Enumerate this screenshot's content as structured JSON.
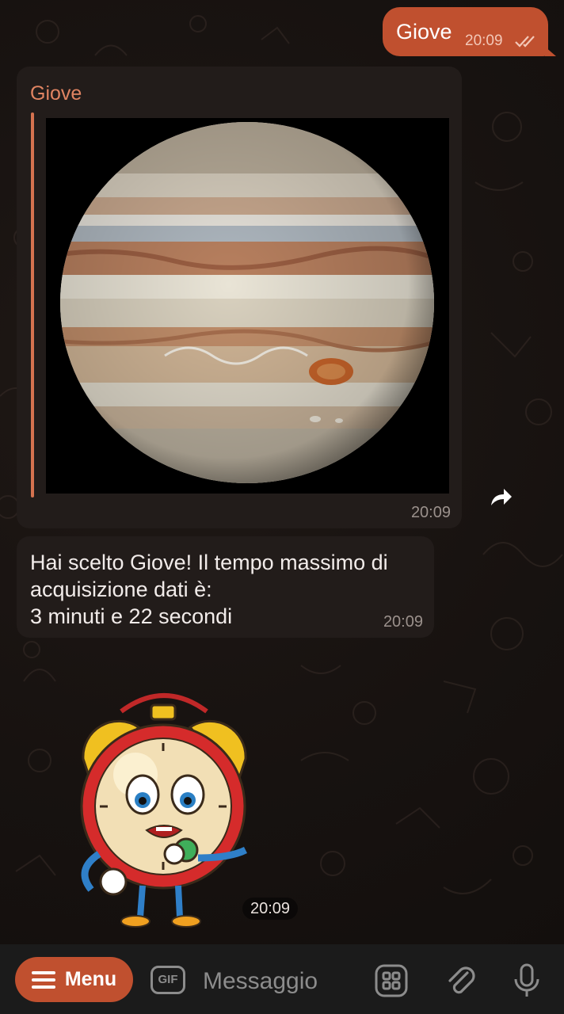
{
  "chat": {
    "outgoing": {
      "text": "Giove",
      "time": "20:09",
      "status_icon": "double-check-icon"
    },
    "image_message": {
      "reply_name": "Giove",
      "photo_subject": "jupiter",
      "time": "20:09"
    },
    "text_message": {
      "lines": [
        "Hai scelto Giove! Il tempo massimo di",
        "acquisizione dati è:",
        "3 minuti e 22 secondi"
      ],
      "time": "20:09"
    },
    "sticker": {
      "subject": "alarm-clock-character",
      "time": "20:09"
    }
  },
  "bottom_bar": {
    "menu_label": "Menu",
    "gif_label": "GIF",
    "message_placeholder": "Messaggio",
    "icons": [
      "menu-icon",
      "gif-icon",
      "sticker-grid-icon",
      "attach-icon",
      "microphone-icon"
    ]
  },
  "colors": {
    "accent": "#c0502f",
    "bubble_in": "#221c1a",
    "background": "#181210",
    "reply_name": "#e08462"
  }
}
